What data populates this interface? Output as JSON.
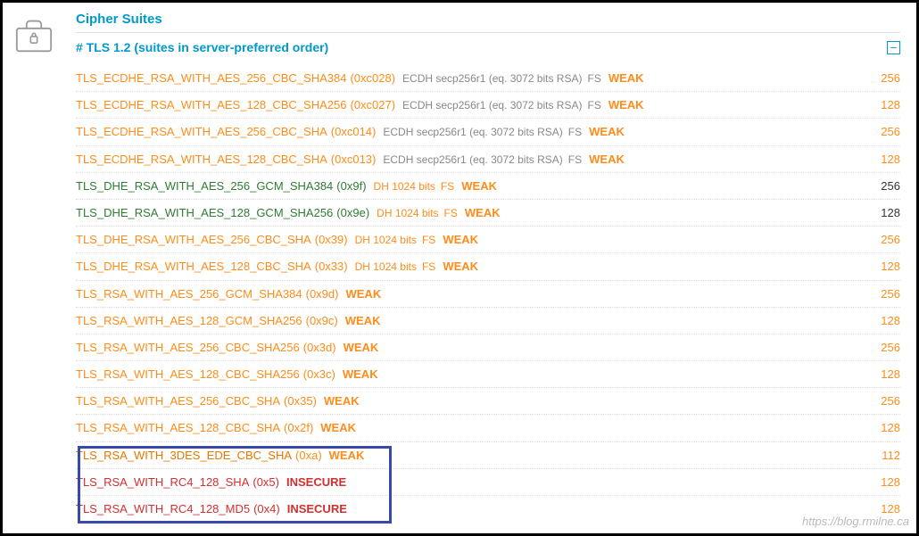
{
  "section_title": "Cipher Suites",
  "subhead": "# TLS 1.2 (suites in server-preferred order)",
  "collapse_symbol": "−",
  "watermark": "https://blog.rmilne.ca",
  "rows": [
    {
      "name": "TLS_ECDHE_RSA_WITH_AES_256_CBC_SHA384",
      "hex": "(0xc028)",
      "name_color": "orange",
      "detail": "ECDH secp256r1 (eq. 3072 bits RSA)",
      "detail_color": "grey",
      "fs": "FS",
      "fs_color": "grey",
      "status": "WEAK",
      "bits": "256",
      "bits_color": "orange"
    },
    {
      "name": "TLS_ECDHE_RSA_WITH_AES_128_CBC_SHA256",
      "hex": "(0xc027)",
      "name_color": "orange",
      "detail": "ECDH secp256r1 (eq. 3072 bits RSA)",
      "detail_color": "grey",
      "fs": "FS",
      "fs_color": "grey",
      "status": "WEAK",
      "bits": "128",
      "bits_color": "orange"
    },
    {
      "name": "TLS_ECDHE_RSA_WITH_AES_256_CBC_SHA",
      "hex": "(0xc014)",
      "name_color": "orange",
      "detail": "ECDH secp256r1 (eq. 3072 bits RSA)",
      "detail_color": "grey",
      "fs": "FS",
      "fs_color": "grey",
      "status": "WEAK",
      "bits": "256",
      "bits_color": "orange"
    },
    {
      "name": "TLS_ECDHE_RSA_WITH_AES_128_CBC_SHA",
      "hex": "(0xc013)",
      "name_color": "orange",
      "detail": "ECDH secp256r1 (eq. 3072 bits RSA)",
      "detail_color": "grey",
      "fs": "FS",
      "fs_color": "grey",
      "status": "WEAK",
      "bits": "128",
      "bits_color": "orange"
    },
    {
      "name": "TLS_DHE_RSA_WITH_AES_256_GCM_SHA384",
      "hex": "(0x9f)",
      "name_color": "green",
      "detail": "DH 1024 bits",
      "detail_color": "orange",
      "fs": "FS",
      "fs_color": "orange",
      "status": "WEAK",
      "bits": "256",
      "bits_color": "black"
    },
    {
      "name": "TLS_DHE_RSA_WITH_AES_128_GCM_SHA256",
      "hex": "(0x9e)",
      "name_color": "green",
      "detail": "DH 1024 bits",
      "detail_color": "orange",
      "fs": "FS",
      "fs_color": "orange",
      "status": "WEAK",
      "bits": "128",
      "bits_color": "black"
    },
    {
      "name": "TLS_DHE_RSA_WITH_AES_256_CBC_SHA",
      "hex": "(0x39)",
      "name_color": "orange",
      "detail": "DH 1024 bits",
      "detail_color": "orange",
      "fs": "FS",
      "fs_color": "orange",
      "status": "WEAK",
      "bits": "256",
      "bits_color": "orange"
    },
    {
      "name": "TLS_DHE_RSA_WITH_AES_128_CBC_SHA",
      "hex": "(0x33)",
      "name_color": "orange",
      "detail": "DH 1024 bits",
      "detail_color": "orange",
      "fs": "FS",
      "fs_color": "orange",
      "status": "WEAK",
      "bits": "128",
      "bits_color": "orange"
    },
    {
      "name": "TLS_RSA_WITH_AES_256_GCM_SHA384",
      "hex": "(0x9d)",
      "name_color": "orange",
      "detail": "",
      "detail_color": "",
      "fs": "",
      "fs_color": "",
      "status": "WEAK",
      "bits": "256",
      "bits_color": "orange"
    },
    {
      "name": "TLS_RSA_WITH_AES_128_GCM_SHA256",
      "hex": "(0x9c)",
      "name_color": "orange",
      "detail": "",
      "detail_color": "",
      "fs": "",
      "fs_color": "",
      "status": "WEAK",
      "bits": "128",
      "bits_color": "orange"
    },
    {
      "name": "TLS_RSA_WITH_AES_256_CBC_SHA256",
      "hex": "(0x3d)",
      "name_color": "orange",
      "detail": "",
      "detail_color": "",
      "fs": "",
      "fs_color": "",
      "status": "WEAK",
      "bits": "256",
      "bits_color": "orange"
    },
    {
      "name": "TLS_RSA_WITH_AES_128_CBC_SHA256",
      "hex": "(0x3c)",
      "name_color": "orange",
      "detail": "",
      "detail_color": "",
      "fs": "",
      "fs_color": "",
      "status": "WEAK",
      "bits": "128",
      "bits_color": "orange"
    },
    {
      "name": "TLS_RSA_WITH_AES_256_CBC_SHA",
      "hex": "(0x35)",
      "name_color": "orange",
      "detail": "",
      "detail_color": "",
      "fs": "",
      "fs_color": "",
      "status": "WEAK",
      "bits": "256",
      "bits_color": "orange"
    },
    {
      "name": "TLS_RSA_WITH_AES_128_CBC_SHA",
      "hex": "(0x2f)",
      "name_color": "orange",
      "detail": "",
      "detail_color": "",
      "fs": "",
      "fs_color": "",
      "status": "WEAK",
      "bits": "128",
      "bits_color": "orange"
    },
    {
      "name": "TLS_RSA_WITH_3DES_EDE_CBC_SHA",
      "hex": "(0xa)",
      "name_color": "oranger",
      "detail": "",
      "detail_color": "",
      "fs": "",
      "fs_color": "",
      "status": "WEAK",
      "bits": "112",
      "bits_color": "orange"
    },
    {
      "name": "TLS_RSA_WITH_RC4_128_SHA",
      "hex": "(0x5)",
      "name_color": "red",
      "detail": "",
      "detail_color": "",
      "fs": "",
      "fs_color": "",
      "status": "INSECURE",
      "bits": "128",
      "bits_color": "orange"
    },
    {
      "name": "TLS_RSA_WITH_RC4_128_MD5",
      "hex": "(0x4)",
      "name_color": "red",
      "detail": "",
      "detail_color": "",
      "fs": "",
      "fs_color": "",
      "status": "INSECURE",
      "bits": "128",
      "bits_color": "orange"
    }
  ]
}
